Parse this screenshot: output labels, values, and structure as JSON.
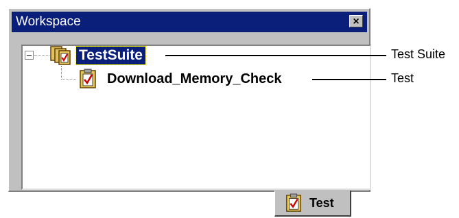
{
  "window": {
    "title": "Workspace",
    "close_glyph": "×",
    "close_icon": "close-icon"
  },
  "tree": {
    "root": {
      "label": "TestSuite",
      "icon": "test-suite-icon",
      "expanded": true,
      "selected": true,
      "children": [
        {
          "label": "Download_Memory_Check",
          "icon": "test-icon"
        }
      ]
    }
  },
  "callouts": [
    {
      "text": "Test Suite"
    },
    {
      "text": "Test"
    }
  ],
  "tabs": [
    {
      "label": "Test",
      "icon": "test-icon",
      "active": true
    }
  ],
  "colors": {
    "titlebar": "#0a1f7a",
    "selection": "#0a1f7a",
    "panel": "#c0c0c0"
  }
}
